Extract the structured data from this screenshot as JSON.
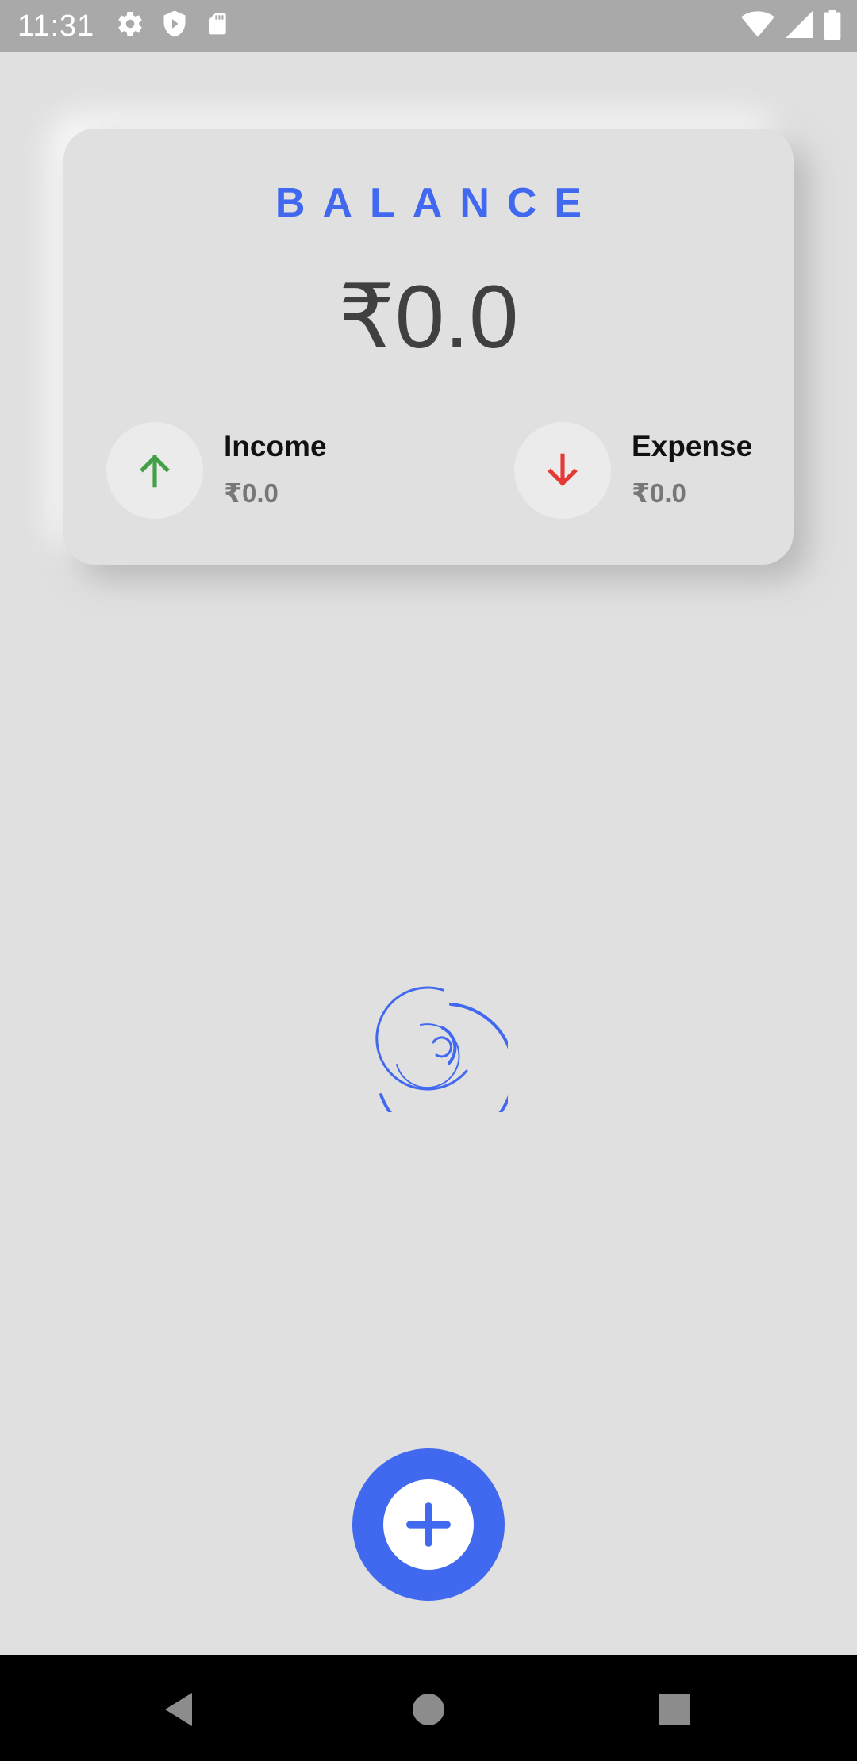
{
  "status_bar": {
    "time": "11:31",
    "left_icons": [
      "gear-icon",
      "shield-icon",
      "sd-card-icon"
    ],
    "right_icons": [
      "wifi-icon",
      "signal-icon",
      "battery-icon"
    ],
    "background": "#a9a9a9"
  },
  "balance_card": {
    "title": "BALANCE",
    "amount": "₹0.0",
    "accent_color": "#4169f0",
    "income": {
      "label": "Income",
      "value": "₹0.0",
      "icon": "arrow-up-icon",
      "icon_color": "#43a047"
    },
    "expense": {
      "label": "Expense",
      "value": "₹0.0",
      "icon": "arrow-down-icon",
      "icon_color": "#e53935"
    }
  },
  "loading": {
    "icon": "loading-spinner-icon",
    "color": "#4169f0"
  },
  "fab": {
    "icon": "plus-icon",
    "color": "#4169f0"
  },
  "nav_bar": {
    "buttons": [
      "back-icon",
      "home-icon",
      "recents-icon"
    ]
  }
}
